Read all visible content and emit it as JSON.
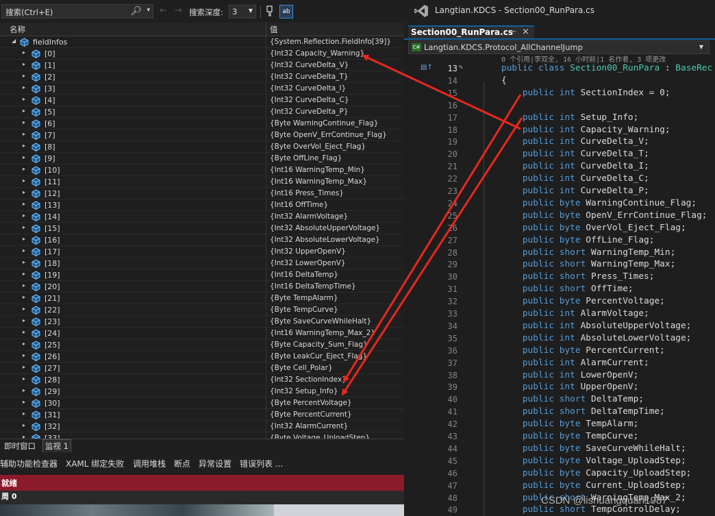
{
  "watch": {
    "search_placeholder": "搜索(Ctrl+E)",
    "depth_label": "搜索深度:",
    "depth_value": "3",
    "ab_label": "ab",
    "col_name": "名称",
    "col_value": "值",
    "root": {
      "name": "fieldInfos",
      "value": "{System.Reflection.FieldInfo[39]}"
    },
    "items": [
      {
        "name": "[0]",
        "value": "{Int32 Capacity_Warning}"
      },
      {
        "name": "[1]",
        "value": "{Int32 CurveDelta_V}"
      },
      {
        "name": "[2]",
        "value": "{Int32 CurveDelta_T}"
      },
      {
        "name": "[3]",
        "value": "{Int32 CurveDelta_I}"
      },
      {
        "name": "[4]",
        "value": "{Int32 CurveDelta_C}"
      },
      {
        "name": "[5]",
        "value": "{Int32 CurveDelta_P}"
      },
      {
        "name": "[6]",
        "value": "{Byte WarningContinue_Flag}"
      },
      {
        "name": "[7]",
        "value": "{Byte OpenV_ErrContinue_Flag}"
      },
      {
        "name": "[8]",
        "value": "{Byte OverVol_Eject_Flag}"
      },
      {
        "name": "[9]",
        "value": "{Byte OffLine_Flag}"
      },
      {
        "name": "[10]",
        "value": "{Int16 WarningTemp_Min}"
      },
      {
        "name": "[11]",
        "value": "{Int16 WarningTemp_Max}"
      },
      {
        "name": "[12]",
        "value": "{Int16 Press_Times}"
      },
      {
        "name": "[13]",
        "value": "{Int16 OffTime}"
      },
      {
        "name": "[14]",
        "value": "{Int32 AlarmVoltage}"
      },
      {
        "name": "[15]",
        "value": "{Int32 AbsoluteUpperVoltage}"
      },
      {
        "name": "[16]",
        "value": "{Int32 AbsoluteLowerVoltage}"
      },
      {
        "name": "[17]",
        "value": "{Int32 UpperOpenV}"
      },
      {
        "name": "[18]",
        "value": "{Int32 LowerOpenV}"
      },
      {
        "name": "[19]",
        "value": "{Int16 DeltaTemp}"
      },
      {
        "name": "[20]",
        "value": "{Int16 DeltaTempTime}"
      },
      {
        "name": "[21]",
        "value": "{Byte TempAlarm}"
      },
      {
        "name": "[22]",
        "value": "{Byte TempCurve}"
      },
      {
        "name": "[23]",
        "value": "{Byte SaveCurveWhileHalt}"
      },
      {
        "name": "[24]",
        "value": "{Int16 WarningTemp_Max_2}"
      },
      {
        "name": "[25]",
        "value": "{Byte Capacity_Sum_Flag}"
      },
      {
        "name": "[26]",
        "value": "{Byte LeakCur_Eject_Flag}"
      },
      {
        "name": "[27]",
        "value": "{Byte Cell_Polar}"
      },
      {
        "name": "[28]",
        "value": "{Int32 SectionIndex}"
      },
      {
        "name": "[29]",
        "value": "{Int32 Setup_Info}"
      },
      {
        "name": "[30]",
        "value": "{Byte PercentVoltage}"
      },
      {
        "name": "[31]",
        "value": "{Byte PercentCurrent}"
      },
      {
        "name": "[32]",
        "value": "{Int32 AlarmCurrent}"
      },
      {
        "name": "[33]",
        "value": "{Byte Voltage_UploadStep}"
      }
    ],
    "tabs": [
      "即时窗口",
      "监视 1"
    ],
    "tool_tabs": [
      "辅助功能检查器",
      "XAML 绑定失败",
      "调用堆栈",
      "断点",
      "异常设置",
      "错误列表 ..."
    ],
    "status": "就绪",
    "status2": "周 0"
  },
  "editor": {
    "window_title": "Langtian.KDCS - Section00_RunPara.cs",
    "tab_label": "Section00_RunPara.cs",
    "nav_value": "Langtian.KDCS.Protocol_AllChannelJump",
    "nav_badge": "C#",
    "codelens": "0 个引用|李双全, 16 小时前|1 名作者, 3 项更改",
    "lines": [
      {
        "n": "13",
        "code": [
          [
            "kw",
            "public "
          ],
          [
            "kw",
            "class "
          ],
          [
            "ty",
            "Section00_RunPara"
          ],
          [
            "p",
            " : "
          ],
          [
            "ty",
            "BaseRec"
          ]
        ]
      },
      {
        "n": "14",
        "code": [
          [
            "p",
            "{"
          ]
        ]
      },
      {
        "n": "15",
        "code": [
          [
            "p",
            "    "
          ],
          [
            "kw",
            "public "
          ],
          [
            "kw",
            "int "
          ],
          [
            "p",
            "SectionIndex = 0;"
          ]
        ]
      },
      {
        "n": "16",
        "code": []
      },
      {
        "n": "17",
        "code": [
          [
            "p",
            "    "
          ],
          [
            "kw",
            "public "
          ],
          [
            "kw",
            "int "
          ],
          [
            "p",
            "Setup_Info;"
          ]
        ]
      },
      {
        "n": "18",
        "code": [
          [
            "p",
            "    "
          ],
          [
            "kw",
            "public "
          ],
          [
            "kw",
            "int "
          ],
          [
            "p",
            "Capacity_Warning;"
          ]
        ]
      },
      {
        "n": "19",
        "code": [
          [
            "p",
            "    "
          ],
          [
            "kw",
            "public "
          ],
          [
            "kw",
            "int "
          ],
          [
            "p",
            "CurveDelta_V;"
          ]
        ]
      },
      {
        "n": "20",
        "code": [
          [
            "p",
            "    "
          ],
          [
            "kw",
            "public "
          ],
          [
            "kw",
            "int "
          ],
          [
            "p",
            "CurveDelta_T;"
          ]
        ]
      },
      {
        "n": "21",
        "code": [
          [
            "p",
            "    "
          ],
          [
            "kw",
            "public "
          ],
          [
            "kw",
            "int "
          ],
          [
            "p",
            "CurveDelta_I;"
          ]
        ]
      },
      {
        "n": "22",
        "code": [
          [
            "p",
            "    "
          ],
          [
            "kw",
            "public "
          ],
          [
            "kw",
            "int "
          ],
          [
            "p",
            "CurveDelta_C;"
          ]
        ]
      },
      {
        "n": "23",
        "code": [
          [
            "p",
            "    "
          ],
          [
            "kw",
            "public "
          ],
          [
            "kw",
            "int "
          ],
          [
            "p",
            "CurveDelta_P;"
          ]
        ]
      },
      {
        "n": "24",
        "code": [
          [
            "p",
            "    "
          ],
          [
            "kw",
            "public "
          ],
          [
            "kw",
            "byte "
          ],
          [
            "p",
            "WarningContinue_Flag;"
          ]
        ]
      },
      {
        "n": "25",
        "code": [
          [
            "p",
            "    "
          ],
          [
            "kw",
            "public "
          ],
          [
            "kw",
            "byte "
          ],
          [
            "p",
            "OpenV_ErrContinue_Flag;"
          ]
        ]
      },
      {
        "n": "26",
        "code": [
          [
            "p",
            "    "
          ],
          [
            "kw",
            "public "
          ],
          [
            "kw",
            "byte "
          ],
          [
            "p",
            "OverVol_Eject_Flag;"
          ]
        ]
      },
      {
        "n": "27",
        "code": [
          [
            "p",
            "    "
          ],
          [
            "kw",
            "public "
          ],
          [
            "kw",
            "byte "
          ],
          [
            "p",
            "OffLine_Flag;"
          ]
        ]
      },
      {
        "n": "28",
        "code": [
          [
            "p",
            "    "
          ],
          [
            "kw",
            "public "
          ],
          [
            "kw",
            "short "
          ],
          [
            "p",
            "WarningTemp_Min;"
          ]
        ]
      },
      {
        "n": "29",
        "code": [
          [
            "p",
            "    "
          ],
          [
            "kw",
            "public "
          ],
          [
            "kw",
            "short "
          ],
          [
            "p",
            "WarningTemp_Max;"
          ]
        ]
      },
      {
        "n": "30",
        "code": [
          [
            "p",
            "    "
          ],
          [
            "kw",
            "public "
          ],
          [
            "kw",
            "short "
          ],
          [
            "p",
            "Press_Times;"
          ]
        ]
      },
      {
        "n": "31",
        "code": [
          [
            "p",
            "    "
          ],
          [
            "kw",
            "public "
          ],
          [
            "kw",
            "short "
          ],
          [
            "p",
            "OffTime;"
          ]
        ]
      },
      {
        "n": "32",
        "code": [
          [
            "p",
            "    "
          ],
          [
            "kw",
            "public "
          ],
          [
            "kw",
            "byte "
          ],
          [
            "p",
            "PercentVoltage;"
          ]
        ]
      },
      {
        "n": "33",
        "code": [
          [
            "p",
            "    "
          ],
          [
            "kw",
            "public "
          ],
          [
            "kw",
            "int "
          ],
          [
            "p",
            "AlarmVoltage;"
          ]
        ]
      },
      {
        "n": "34",
        "code": [
          [
            "p",
            "    "
          ],
          [
            "kw",
            "public "
          ],
          [
            "kw",
            "int "
          ],
          [
            "p",
            "AbsoluteUpperVoltage;"
          ]
        ]
      },
      {
        "n": "35",
        "code": [
          [
            "p",
            "    "
          ],
          [
            "kw",
            "public "
          ],
          [
            "kw",
            "int "
          ],
          [
            "p",
            "AbsoluteLowerVoltage;"
          ]
        ]
      },
      {
        "n": "36",
        "code": [
          [
            "p",
            "    "
          ],
          [
            "kw",
            "public "
          ],
          [
            "kw",
            "byte "
          ],
          [
            "p",
            "PercentCurrent;"
          ]
        ]
      },
      {
        "n": "37",
        "code": [
          [
            "p",
            "    "
          ],
          [
            "kw",
            "public "
          ],
          [
            "kw",
            "int "
          ],
          [
            "p",
            "AlarmCurrent;"
          ]
        ]
      },
      {
        "n": "38",
        "code": [
          [
            "p",
            "    "
          ],
          [
            "kw",
            "public "
          ],
          [
            "kw",
            "int "
          ],
          [
            "p",
            "LowerOpenV;"
          ]
        ]
      },
      {
        "n": "39",
        "code": [
          [
            "p",
            "    "
          ],
          [
            "kw",
            "public "
          ],
          [
            "kw",
            "int "
          ],
          [
            "p",
            "UpperOpenV;"
          ]
        ]
      },
      {
        "n": "40",
        "code": [
          [
            "p",
            "    "
          ],
          [
            "kw",
            "public "
          ],
          [
            "kw",
            "short "
          ],
          [
            "p",
            "DeltaTemp;"
          ]
        ]
      },
      {
        "n": "41",
        "code": [
          [
            "p",
            "    "
          ],
          [
            "kw",
            "public "
          ],
          [
            "kw",
            "short "
          ],
          [
            "p",
            "DeltaTempTime;"
          ]
        ]
      },
      {
        "n": "42",
        "code": [
          [
            "p",
            "    "
          ],
          [
            "kw",
            "public "
          ],
          [
            "kw",
            "byte "
          ],
          [
            "p",
            "TempAlarm;"
          ]
        ]
      },
      {
        "n": "43",
        "code": [
          [
            "p",
            "    "
          ],
          [
            "kw",
            "public "
          ],
          [
            "kw",
            "byte "
          ],
          [
            "p",
            "TempCurve;"
          ]
        ]
      },
      {
        "n": "44",
        "code": [
          [
            "p",
            "    "
          ],
          [
            "kw",
            "public "
          ],
          [
            "kw",
            "byte "
          ],
          [
            "p",
            "SaveCurveWhileHalt;"
          ]
        ]
      },
      {
        "n": "45",
        "code": [
          [
            "p",
            "    "
          ],
          [
            "kw",
            "public "
          ],
          [
            "kw",
            "byte "
          ],
          [
            "p",
            "Voltage_UploadStep;"
          ]
        ]
      },
      {
        "n": "46",
        "code": [
          [
            "p",
            "    "
          ],
          [
            "kw",
            "public "
          ],
          [
            "kw",
            "byte "
          ],
          [
            "p",
            "Capacity_UploadStep;"
          ]
        ]
      },
      {
        "n": "47",
        "code": [
          [
            "p",
            "    "
          ],
          [
            "kw",
            "public "
          ],
          [
            "kw",
            "byte "
          ],
          [
            "p",
            "Current_UploadStep;"
          ]
        ]
      },
      {
        "n": "48",
        "code": [
          [
            "p",
            "    "
          ],
          [
            "kw",
            "public "
          ],
          [
            "kw",
            "short "
          ],
          [
            "p",
            "WarningTemp_Max_2;"
          ]
        ]
      },
      {
        "n": "49",
        "code": [
          [
            "p",
            "    "
          ],
          [
            "kw",
            "public "
          ],
          [
            "kw",
            "short "
          ],
          [
            "p",
            "TempControlDelay;"
          ]
        ]
      }
    ]
  },
  "watermark": "CSDN @lishuangquan1987",
  "colors": {
    "accent": "#0e639c",
    "status": "#8b1a2b",
    "arrow": "#e8281e",
    "keyword": "#569cd6",
    "type": "#4ec9b0"
  }
}
